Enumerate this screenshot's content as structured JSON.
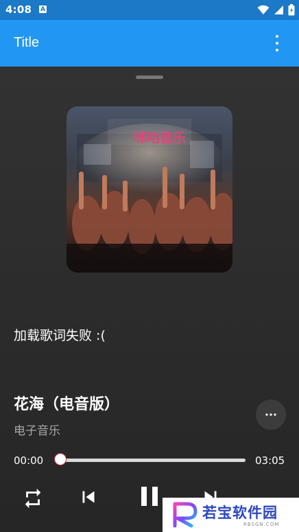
{
  "status_bar": {
    "time": "4:08",
    "app_badge": "A",
    "icons": [
      "wifi-icon",
      "signal-icon",
      "battery-icon"
    ]
  },
  "app_bar": {
    "title": "Title",
    "menu_icon": "more-vert-icon"
  },
  "player": {
    "cover_logo_text": "咪咕音乐",
    "lyrics_message": "加载歌词失败 :(",
    "song_title": "花海（电音版）",
    "song_artist": "电子音乐",
    "more_icon": "more-horiz-icon",
    "current_time": "00:00",
    "total_time": "03:05",
    "progress": 0.0,
    "controls": [
      "repeat-icon",
      "skip-previous-icon",
      "pause-icon",
      "skip-next-icon"
    ]
  },
  "watermark": {
    "brand": "若宝软件园",
    "domain": "RBSGN.COM"
  },
  "colors": {
    "app_bar": "#2196f3",
    "status_bar": "#1c79c8",
    "sheet_background": "#2b2b2b",
    "artist_text": "#a8a8a8",
    "progress_thumb_border": "#c62828"
  }
}
